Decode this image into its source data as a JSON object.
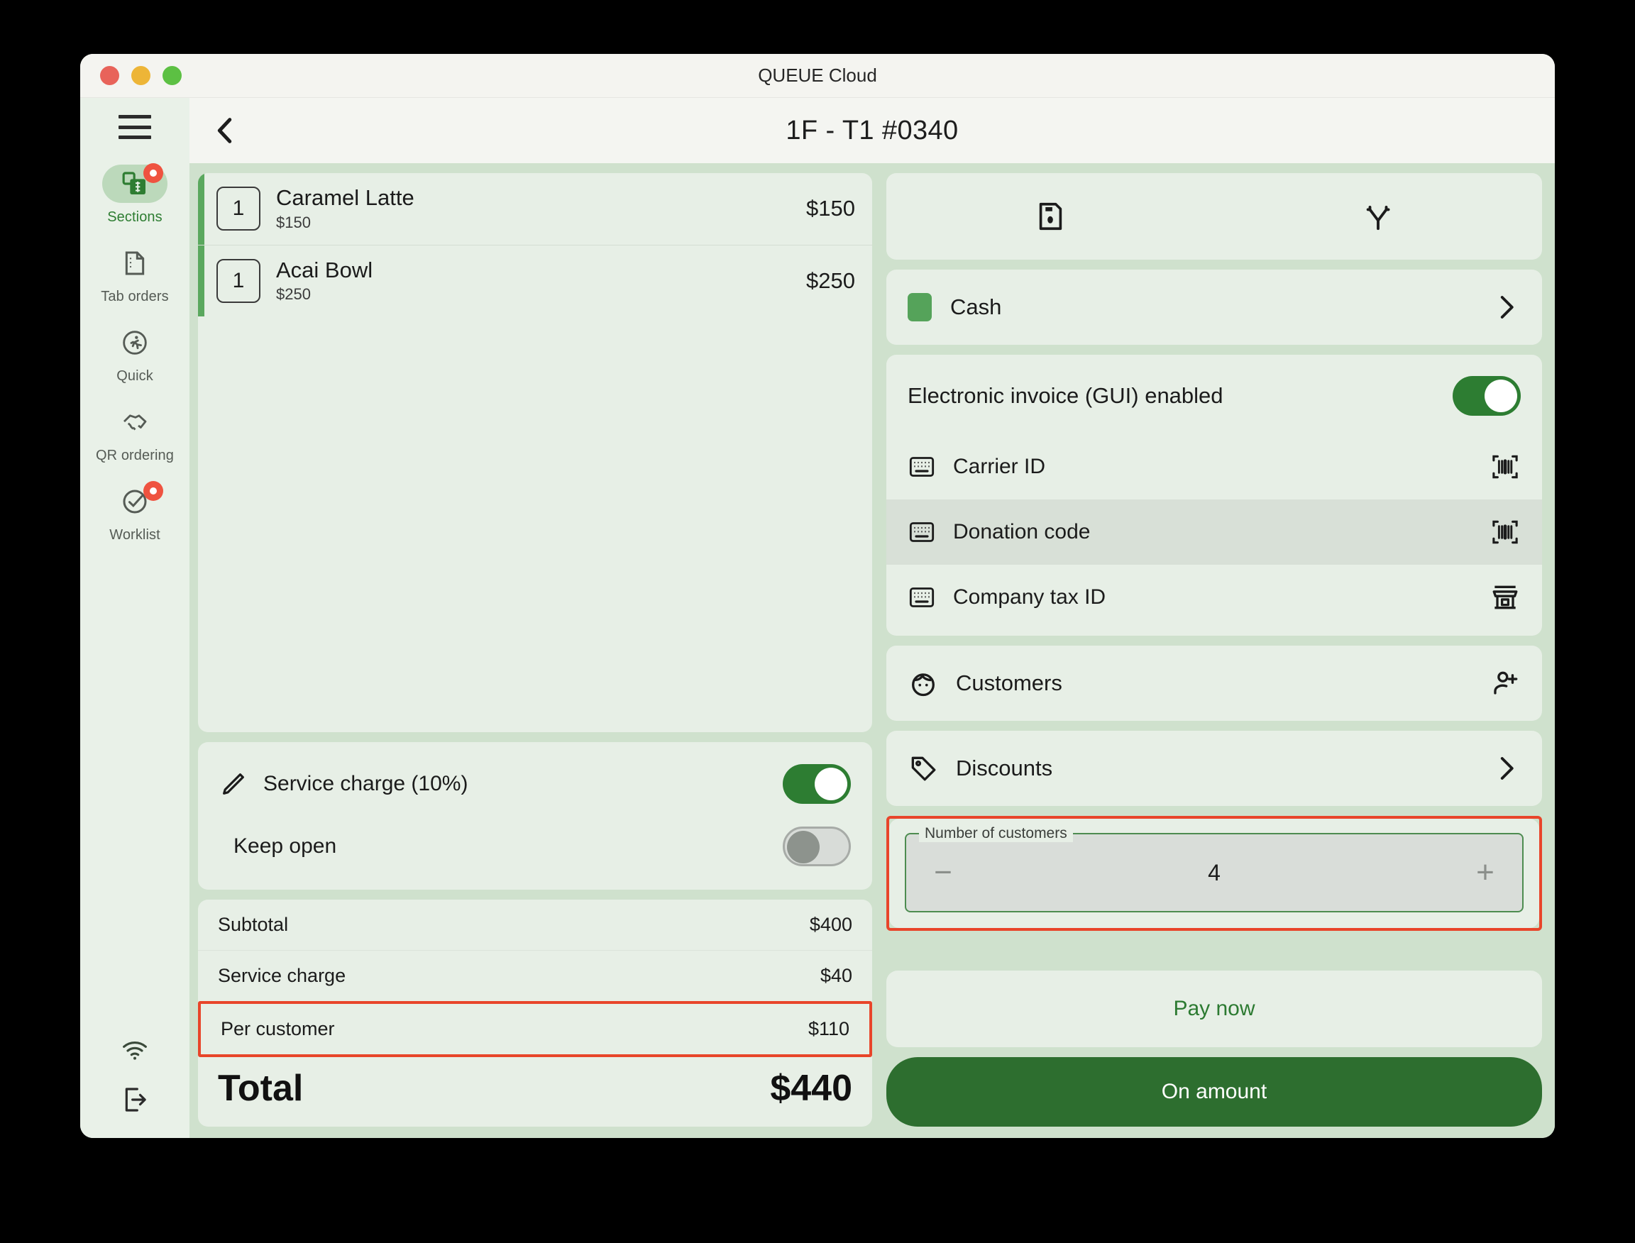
{
  "window": {
    "title": "QUEUE Cloud",
    "traffic_lights": [
      "close-red",
      "minimize-yellow",
      "maximize-green"
    ]
  },
  "sidebar": {
    "menu_icon": "hamburger-icon",
    "items": [
      {
        "label": "Sections",
        "icon": "sections-grid-icon",
        "active": true,
        "badge": true
      },
      {
        "label": "Tab orders",
        "icon": "document-icon",
        "active": false,
        "badge": false
      },
      {
        "label": "Quick",
        "icon": "running-person-icon",
        "active": false,
        "badge": false
      },
      {
        "label": "QR ordering",
        "icon": "handshake-icon",
        "active": false,
        "badge": false
      },
      {
        "label": "Worklist",
        "icon": "check-circle-icon",
        "active": false,
        "badge": true
      }
    ],
    "footer_icons": [
      "wifi-icon",
      "logout-icon"
    ]
  },
  "topbar": {
    "back_icon": "chevron-left-icon",
    "order_title": "1F - T1 #0340"
  },
  "order": {
    "items": [
      {
        "qty": "1",
        "name": "Caramel Latte",
        "unit_price": "$150",
        "line_total": "$150"
      },
      {
        "qty": "1",
        "name": "Acai Bowl",
        "unit_price": "$250",
        "line_total": "$250"
      }
    ]
  },
  "options": {
    "service_charge": {
      "label": "Service charge (10%)",
      "icon": "pencil-icon",
      "on": true
    },
    "keep_open": {
      "label": "Keep open",
      "on": false
    }
  },
  "totals": {
    "rows": [
      {
        "label": "Subtotal",
        "value": "$400",
        "highlight": false
      },
      {
        "label": "Service charge",
        "value": "$40",
        "highlight": false
      },
      {
        "label": "Per customer",
        "value": "$110",
        "highlight": true
      }
    ],
    "grand_label": "Total",
    "grand_value": "$440"
  },
  "actions": {
    "save_icon": "save-floppy-icon",
    "split_icon": "split-arrow-icon"
  },
  "payment": {
    "method_label": "Cash",
    "method_swatch_color": "#55a35a",
    "chevron_icon": "chevron-right-icon"
  },
  "einvoice": {
    "title": "Electronic invoice (GUI) enabled",
    "enabled": true,
    "fields": [
      {
        "label": "Carrier ID",
        "lead_icon": "keyboard-icon",
        "trail_icon": "barcode-scan-icon",
        "selected": false
      },
      {
        "label": "Donation code",
        "lead_icon": "keyboard-icon",
        "trail_icon": "barcode-scan-icon",
        "selected": true
      },
      {
        "label": "Company tax ID",
        "lead_icon": "keyboard-icon",
        "trail_icon": "store-icon",
        "selected": false
      }
    ]
  },
  "customers_row": {
    "label": "Customers",
    "lead_icon": "face-icon",
    "trail_icon": "person-add-icon"
  },
  "discounts_row": {
    "label": "Discounts",
    "lead_icon": "tag-icon",
    "trail_icon": "chevron-right-icon"
  },
  "customer_count": {
    "legend": "Number of customers",
    "value": "4",
    "minus_label": "−",
    "plus_label": "+"
  },
  "buttons": {
    "pay_now": "Pay now",
    "on_amount": "On amount"
  },
  "colors": {
    "accent_green": "#2d7d32",
    "highlight_red": "#e8452a",
    "badge_red": "#ef5340",
    "panel_bg": "#e7efe6",
    "main_bg": "#cfe1cd"
  }
}
